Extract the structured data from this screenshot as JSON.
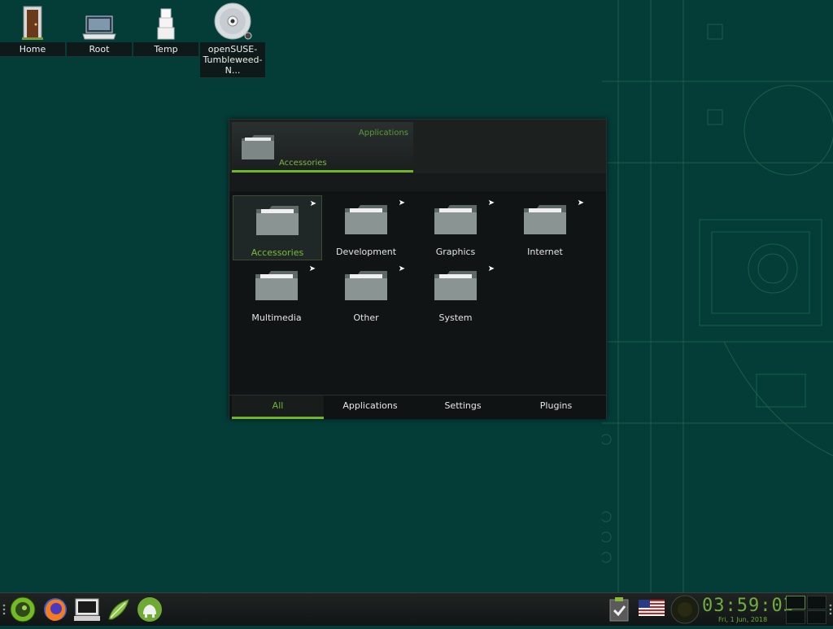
{
  "desktop": {
    "icons": [
      {
        "label": "Home",
        "icon": "door-icon"
      },
      {
        "label": "Root",
        "icon": "laptop-icon"
      },
      {
        "label": "Temp",
        "icon": "boxes-icon"
      },
      {
        "label": "openSUSE-Tumbleweed-N...",
        "icon": "cd-icon"
      }
    ]
  },
  "menu": {
    "breadcrumb": {
      "parent": "Applications",
      "current": "Accessories"
    },
    "categories": [
      {
        "label": "Accessories",
        "selected": true
      },
      {
        "label": "Development"
      },
      {
        "label": "Graphics"
      },
      {
        "label": "Internet"
      },
      {
        "label": "Multimedia"
      },
      {
        "label": "Other"
      },
      {
        "label": "System"
      }
    ],
    "tabs": [
      {
        "label": "All",
        "active": true
      },
      {
        "label": "Applications"
      },
      {
        "label": "Settings"
      },
      {
        "label": "Plugins"
      }
    ]
  },
  "taskbar": {
    "launchers": [
      "opensuse-start-icon",
      "firefox-icon",
      "terminal-icon",
      "text-editor-icon",
      "file-manager-icon"
    ],
    "tray": {
      "time": "03:59:03",
      "date": "Fri, 1 Jun, 2018",
      "keyboard_layout": "us-flag-icon"
    }
  },
  "colors": {
    "accent": "#6fb62c",
    "desktop_bg": "#043c38",
    "menu_bg": "#101414"
  }
}
